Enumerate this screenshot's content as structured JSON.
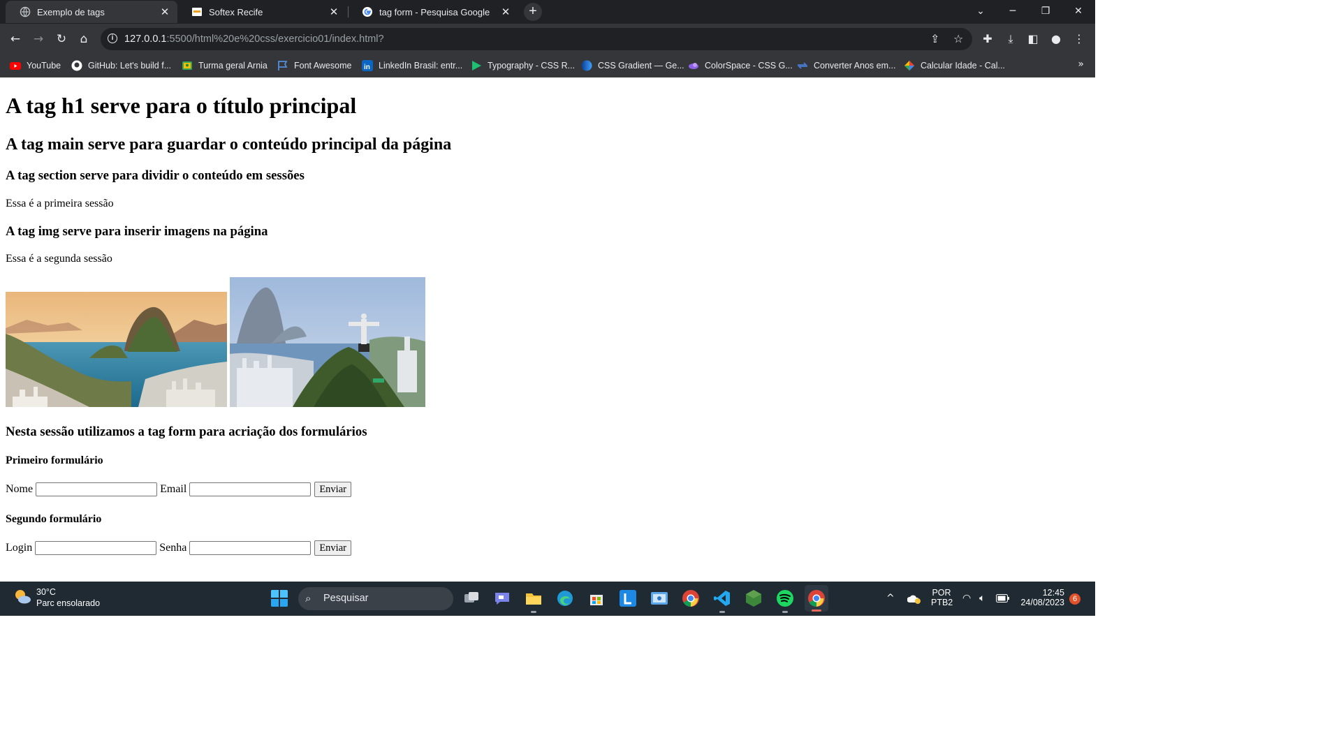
{
  "browser": {
    "tabs": [
      {
        "title": "Exemplo de tags",
        "active": true
      },
      {
        "title": "Softex Recife",
        "active": false
      },
      {
        "title": "tag form - Pesquisa Google",
        "active": false
      }
    ],
    "url_host": "127.0.0.1",
    "url_rest": ":5500/html%20e%20css/exercicio01/index.html?",
    "bookmarks": [
      {
        "label": "YouTube",
        "icon": "youtube-icon",
        "color": "#ff0000"
      },
      {
        "label": "GitHub: Let's build f...",
        "icon": "github-icon",
        "color": "#ffffff"
      },
      {
        "label": "Turma geral Arnia",
        "icon": "google-classroom-icon",
        "color": "#34a853"
      },
      {
        "label": "Font Awesome",
        "icon": "flag-icon",
        "color": "#538dd7"
      },
      {
        "label": "LinkedIn Brasil: entr...",
        "icon": "linkedin-icon",
        "color": "#0a66c2"
      },
      {
        "label": "Typography - CSS R...",
        "icon": "typography-icon",
        "color": "#1dbf73"
      },
      {
        "label": "CSS Gradient — Ge...",
        "icon": "css-gradient-icon",
        "color": "#1e6fd9"
      },
      {
        "label": "ColorSpace - CSS G...",
        "icon": "colorspace-icon",
        "color": "#8c62e6"
      },
      {
        "label": "Converter Anos em...",
        "icon": "converter-icon",
        "color": "#4a7bd0"
      },
      {
        "label": "Calcular Idade - Cal...",
        "icon": "calculator-icon",
        "color": "#e94235"
      }
    ]
  },
  "page": {
    "h1": "A tag h1 serve para o título principal",
    "h2_main": "A tag main serve para guardar o conteúdo principal da página",
    "h3_section": "A tag section serve para dividir o conteúdo em sessões",
    "p_first": "Essa é a primeira sessão",
    "h3_img": "A tag img serve para inserir imagens na página",
    "p_second": "Essa é a segunda sessão",
    "h3_form": "Nesta sessão utilizamos a tag form para acriação dos formulários",
    "form1": {
      "title": "Primeiro formulário",
      "label1": "Nome",
      "label2": "Email",
      "value1": "",
      "value2": "",
      "submit": "Enviar"
    },
    "form2": {
      "title": "Segundo formulário",
      "label1": "Login",
      "label2": "Senha",
      "value1": "",
      "value2": "",
      "submit": "Enviar"
    }
  },
  "taskbar": {
    "temperature": "30°C",
    "weather": "Parc ensolarado",
    "search_placeholder": "Pesquisar",
    "language": "POR",
    "layout": "PTB2",
    "time": "12:45",
    "date": "24/08/2023",
    "notifications": "6"
  },
  "colors": {
    "tabstrip": "#202124",
    "toolbar": "#35363a",
    "taskbar": "#202a33"
  }
}
